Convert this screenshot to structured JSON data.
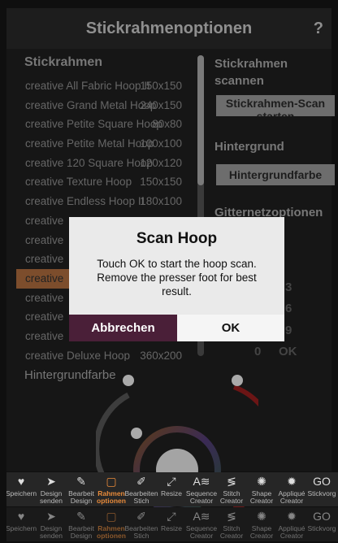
{
  "header": {
    "title": "Stickrahmenoptionen",
    "help": "?"
  },
  "hoops": {
    "section_title": "Stickrahmen",
    "items": [
      {
        "name": "creative All Fabric Hoop II",
        "size": "150x150"
      },
      {
        "name": "creative Grand Metal Hoop",
        "size": "240x150"
      },
      {
        "name": "creative Petite Square Hoop",
        "size": "80x80"
      },
      {
        "name": "creative Petite Metal Hoop",
        "size": "100x100"
      },
      {
        "name": "creative 120 Square Hoop",
        "size": "120x120"
      },
      {
        "name": "creative Texture Hoop",
        "size": "150x150"
      },
      {
        "name": "creative Endless Hoop II",
        "size": "180x100"
      },
      {
        "name": "creative",
        "size": ""
      },
      {
        "name": "creative",
        "size": ""
      },
      {
        "name": "creative",
        "size": ""
      },
      {
        "name": "creative",
        "size": ""
      },
      {
        "name": "creative",
        "size": ""
      },
      {
        "name": "creative",
        "size": ""
      },
      {
        "name": "creative",
        "size": ""
      },
      {
        "name": "creative Deluxe Hoop",
        "size": "360x200"
      }
    ]
  },
  "scan": {
    "title": "Stickrahmen scannen",
    "button": "Stickrahmen-Scan starten"
  },
  "background": {
    "title": "Hintergrund",
    "button": "Hintergrundfarbe",
    "color_label": "Hintergrundfarbe"
  },
  "grid": {
    "title": "Gitternetzoptionen",
    "values": [
      "3",
      "6",
      "9"
    ],
    "current": "0",
    "ok": "OK"
  },
  "modal": {
    "title": "Scan Hoop",
    "message": "Touch OK to start the hoop scan. Remove the presser foot for best result.",
    "cancel": "Abbrechen",
    "ok": "OK"
  },
  "toolbar": {
    "items": [
      {
        "label": "Speichern",
        "icon": "heart-icon",
        "glyph": "♥"
      },
      {
        "label": "Design senden",
        "icon": "send-icon",
        "glyph": "➤"
      },
      {
        "label": "Bearbeit Design",
        "icon": "edit-design-icon",
        "glyph": "✎"
      },
      {
        "label": "Rahmen optionen",
        "icon": "hoop-icon",
        "glyph": "▢"
      },
      {
        "label": "Bearbeiten Stich",
        "icon": "edit-stitch-icon",
        "glyph": "✐"
      },
      {
        "label": "Resize",
        "icon": "resize-icon",
        "glyph": "⤢"
      },
      {
        "label": "Sequence Creator",
        "icon": "sequence-icon",
        "glyph": "A≋"
      },
      {
        "label": "Stitch Creator",
        "icon": "stitch-icon",
        "glyph": "≶"
      },
      {
        "label": "Shape Creator",
        "icon": "shape-icon",
        "glyph": "✺"
      },
      {
        "label": "Appliqué Creator",
        "icon": "applique-icon",
        "glyph": "✹"
      },
      {
        "label": "Stickvorg",
        "icon": "go-icon",
        "glyph": "GO"
      }
    ],
    "active_index": 3
  }
}
